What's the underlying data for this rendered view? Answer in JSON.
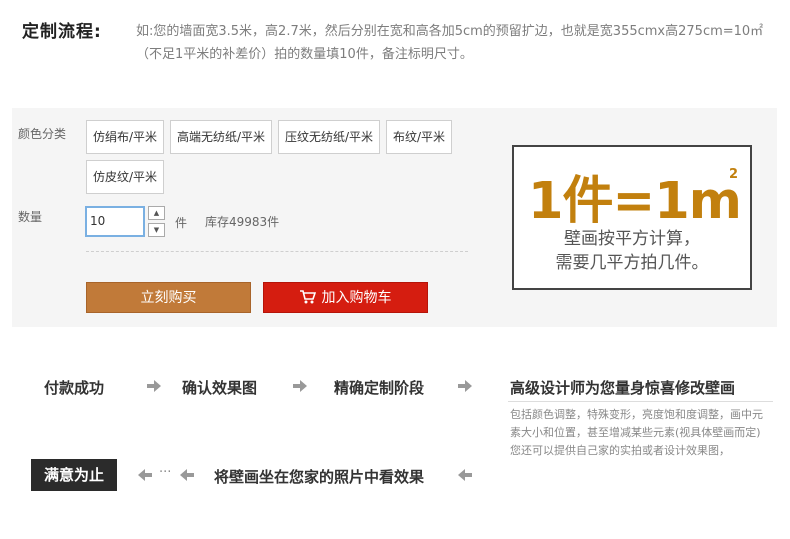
{
  "header": {
    "title": "定制流程:",
    "description": "如:您的墙面宽3.5米，高2.7米，然后分别在宽和高各加5cm的预留扩边，也就是宽355cmx高275cm=10㎡（不足1平米的补差价）拍的数量填10件，备注标明尺寸。"
  },
  "product": {
    "color_label": "颜色分类",
    "options": [
      "仿绢布/平米",
      "高端无纺纸/平米",
      "压纹无纺纸/平米",
      "布纹/平米",
      "仿皮纹/平米"
    ],
    "quantity_label": "数量",
    "quantity_value": "10",
    "unit": "件",
    "stock": "库存49983件",
    "stepper_up": "▲",
    "stepper_down": "▼",
    "buy_now": "立刻购买",
    "add_to_cart": "加入购物车"
  },
  "promo": {
    "headline": "1件=1m",
    "superscript": "2",
    "line1": "壁画按平方计算，",
    "line2": "需要几平方拍几件。",
    "accent_color": "#c2800e"
  },
  "process": {
    "steps": [
      "付款成功",
      "确认效果图",
      "精确定制阶段",
      "高级设计师为您量身惊喜修改壁画",
      "将壁画坐在您家的照片中看效果",
      "满意为止"
    ],
    "designer_note": "包括颜色调整，特殊变形，亮度饱和度调整，画中元素大小和位置，甚至增减某些元素(视具体壁画而定)您还可以提供自己家的实拍或者设计效果图，",
    "ellipsis": "···"
  }
}
